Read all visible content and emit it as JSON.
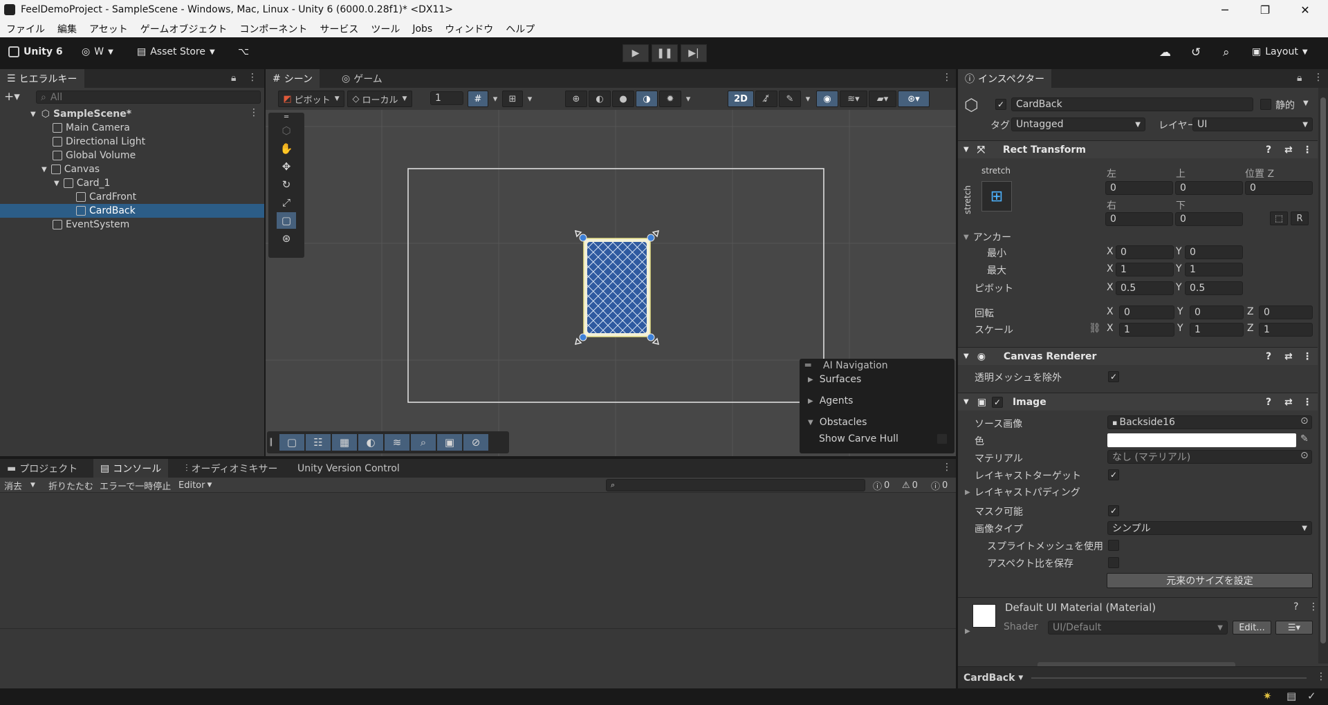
{
  "window": {
    "title": "FeelDemoProject - SampleScene - Windows, Mac, Linux - Unity 6 (6000.0.28f1)* <DX11>"
  },
  "menu": [
    "ファイル",
    "編集",
    "アセット",
    "ゲームオブジェクト",
    "コンポーネント",
    "サービス",
    "ツール",
    "Jobs",
    "ウィンドウ",
    "ヘルプ"
  ],
  "toolbar": {
    "unity_label": "Unity 6",
    "account_label": "W",
    "asset_store_label": "Asset Store",
    "layout_label": "Layout"
  },
  "hierarchy": {
    "tab_label": "ヒエラルキー",
    "search_placeholder": "All",
    "scene_name": "SampleScene*",
    "items": [
      "Main Camera",
      "Directional Light",
      "Global Volume",
      "Canvas",
      "Card_1",
      "CardFront",
      "CardBack",
      "EventSystem"
    ]
  },
  "scene": {
    "tab_scene": "シーン",
    "tab_game": "ゲーム",
    "pivot_label": "ピボット",
    "local_label": "ローカル",
    "grid_value": "1",
    "mode_2d": "2D",
    "ai_nav": {
      "title": "AI Navigation",
      "surfaces": "Surfaces",
      "agents": "Agents",
      "obstacles": "Obstacles",
      "show_carve_hull": "Show Carve Hull"
    }
  },
  "bottom": {
    "tabs": [
      "プロジェクト",
      "コンソール",
      "オーディオミキサー",
      "Unity Version Control"
    ],
    "clear_label": "消去",
    "collapse_label": "折りたたむ",
    "error_pause_label": "エラーで一時停止",
    "editor_label": "Editor",
    "counts": {
      "logs": "0",
      "warnings": "0",
      "errors": "0"
    }
  },
  "inspector": {
    "tab_label": "インスペクター",
    "object_name": "CardBack",
    "static_label": "静的",
    "tag_label": "タグ",
    "tag_value": "Untagged",
    "layer_label": "レイヤー",
    "layer_value": "UI",
    "rect_transform": {
      "title": "Rect Transform",
      "stretch_top": "stretch",
      "stretch_side": "stretch",
      "left_label": "左",
      "top_label": "上",
      "posz_label": "位置 Z",
      "left": "0",
      "top": "0",
      "posz": "0",
      "right_label": "右",
      "bottom_label": "下",
      "right": "0",
      "bottom": "0",
      "anchors_label": "アンカー",
      "min_label": "最小",
      "max_label": "最大",
      "min_x": "0",
      "min_y": "0",
      "max_x": "1",
      "max_y": "1",
      "pivot_label": "ピボット",
      "pivot_x": "0.5",
      "pivot_y": "0.5",
      "rotation_label": "回転",
      "rot_x": "0",
      "rot_y": "0",
      "rot_z": "0",
      "scale_label": "スケール",
      "scale_x": "1",
      "scale_y": "1",
      "scale_z": "1",
      "x": "X",
      "y": "Y",
      "z": "Z"
    },
    "canvas_renderer": {
      "title": "Canvas Renderer",
      "cull_label": "透明メッシュを除外"
    },
    "image": {
      "title": "Image",
      "source_label": "ソース画像",
      "source_value": "Backside16",
      "color_label": "色",
      "material_label": "マテリアル",
      "material_value": "なし (マテリアル)",
      "raycast_target_label": "レイキャストターゲット",
      "raycast_padding_label": "レイキャストパディング",
      "maskable_label": "マスク可能",
      "image_type_label": "画像タイプ",
      "image_type_value": "シンプル",
      "sprite_mesh_label": "スプライトメッシュを使用",
      "preserve_aspect_label": "アスペクト比を保存",
      "native_size_label": "元来のサイズを設定"
    },
    "material": {
      "title": "Default UI Material (Material)",
      "shader_label": "Shader",
      "shader_value": "UI/Default",
      "edit_label": "Edit..."
    },
    "footer_label": "CardBack"
  },
  "colors": {
    "accent": "#2c5d87",
    "selection": "#2c5d87",
    "card_blue": "#2f5aa0"
  }
}
